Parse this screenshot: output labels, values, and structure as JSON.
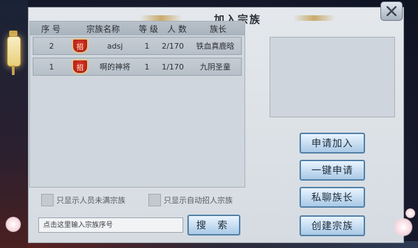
{
  "window": {
    "title": "加入宗族",
    "close_icon": "close-icon"
  },
  "table": {
    "headers": [
      "序 号",
      "宗族名称",
      "等 级",
      "人 数",
      "族长"
    ],
    "rows": [
      {
        "index": "2",
        "badge": "招",
        "name": "adsj",
        "level": "1",
        "members": "2/170",
        "leader": "铁血真鹿晗"
      },
      {
        "index": "1",
        "badge": "招",
        "name": "啊的神将",
        "level": "1",
        "members": "1/170",
        "leader": "九阴圣童"
      }
    ]
  },
  "filters": {
    "not_full": "只显示人员未满宗族",
    "auto_recruit": "只显示自动招人宗族"
  },
  "search": {
    "placeholder": "点击这里输入宗族序号",
    "button": "搜 索"
  },
  "actions": {
    "apply": "申请加入",
    "one_click_apply": "一键申请",
    "message_leader": "私聊族长",
    "create_clan": "创建宗族"
  }
}
